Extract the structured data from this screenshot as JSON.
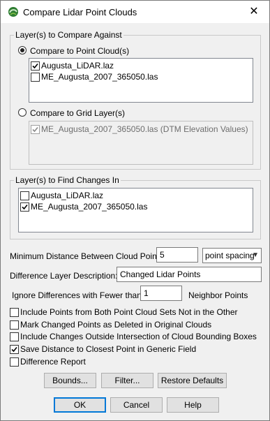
{
  "window": {
    "title": "Compare Lidar Point Clouds",
    "close_glyph": "✕"
  },
  "compare_against": {
    "group_label": "Layer(s) to Compare Against",
    "point_cloud_radio": {
      "label": "Compare to Point Cloud(s)",
      "selected": true
    },
    "point_cloud_items": [
      {
        "label": "Augusta_LiDAR.laz",
        "checked": true
      },
      {
        "label": "ME_Augusta_2007_365050.las",
        "checked": false
      }
    ],
    "grid_radio": {
      "label": "Compare to Grid Layer(s)",
      "selected": false
    },
    "grid_items": [
      {
        "label": "ME_Augusta_2007_365050.las (DTM Elevation Values)",
        "checked": true,
        "disabled": true
      }
    ]
  },
  "find_changes": {
    "group_label": "Layer(s) to Find Changes In",
    "items": [
      {
        "label": "Augusta_LiDAR.laz",
        "checked": false
      },
      {
        "label": "ME_Augusta_2007_365050.las",
        "checked": true
      }
    ]
  },
  "settings": {
    "min_distance_label": "Minimum Distance Between Cloud Points:",
    "min_distance_value": "5",
    "distance_unit": "point spacing",
    "diff_desc_label": "Difference Layer Description:",
    "diff_desc_value": "Changed Lidar Points",
    "ignore_label": "Ignore Differences with Fewer than",
    "ignore_value": "1",
    "ignore_suffix": "Neighbor Points"
  },
  "options": [
    {
      "label": "Include Points from Both Point Cloud Sets Not in the Other",
      "checked": false
    },
    {
      "label": "Mark Changed Points as Deleted in Original Clouds",
      "checked": false
    },
    {
      "label": "Include Changes Outside Intersection of Cloud Bounding Boxes",
      "checked": false
    },
    {
      "label": "Save Distance to Closest Point in Generic Field",
      "checked": true
    },
    {
      "label": "Difference Report",
      "checked": false
    }
  ],
  "buttons": {
    "bounds": "Bounds...",
    "filter": "Filter...",
    "restore": "Restore Defaults",
    "ok": "OK",
    "cancel": "Cancel",
    "help": "Help"
  }
}
